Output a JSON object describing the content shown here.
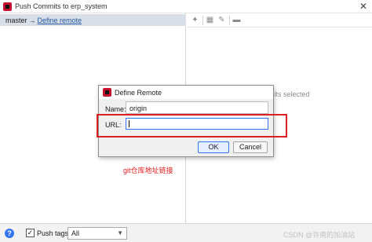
{
  "window": {
    "title": "Push Commits to erp_system",
    "close_label": "✕"
  },
  "left_pane": {
    "branch": "master",
    "arrow": "→",
    "remote_link": "Define remote"
  },
  "right_pane": {
    "toolbar_icons": [
      "branch-compare-icon",
      "grid-icon",
      "edit-icon",
      "save-icon"
    ],
    "empty_text": "mits selected"
  },
  "bottom": {
    "push_tags_checked": true,
    "push_tags_label": "Push tags:",
    "tags_value": "All",
    "watermark": "CSDN @许南的加油站"
  },
  "dialog": {
    "title": "Define Remote",
    "name_label": "Name:",
    "name_value": "origin",
    "url_label": "URL:",
    "url_value": "",
    "ok_label": "OK",
    "cancel_label": "Cancel"
  },
  "annotation": {
    "text": "git仓库地址链接",
    "color": "#e02020"
  },
  "colors": {
    "accent": "#3574f0",
    "selection": "#d9dfe8",
    "link": "#2358a5",
    "highlight": "#e02020"
  }
}
